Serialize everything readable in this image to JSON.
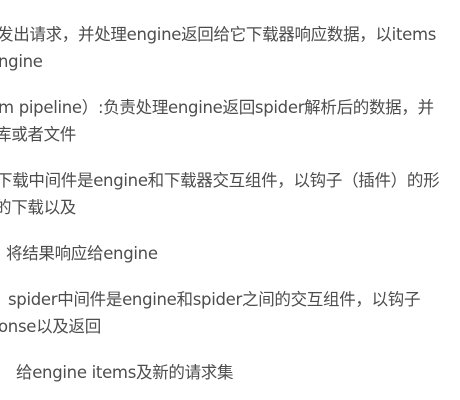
{
  "lines": [
    "发出请求，并处理engine返回给它下载器响应数据，以items",
    "ngine",
    "m pipeline）:负责处理engine返回spider解析后的数据，并",
    "库或者文件",
    "下载中间件是engine和下载器交互组件，以钩子（插件）的形",
    "的下载以及",
    "将结果响应给engine",
    "spider中间件是engine和spider之间的交互组件，以钩子",
    "onse以及返回",
    "给engine items及新的请求集"
  ]
}
